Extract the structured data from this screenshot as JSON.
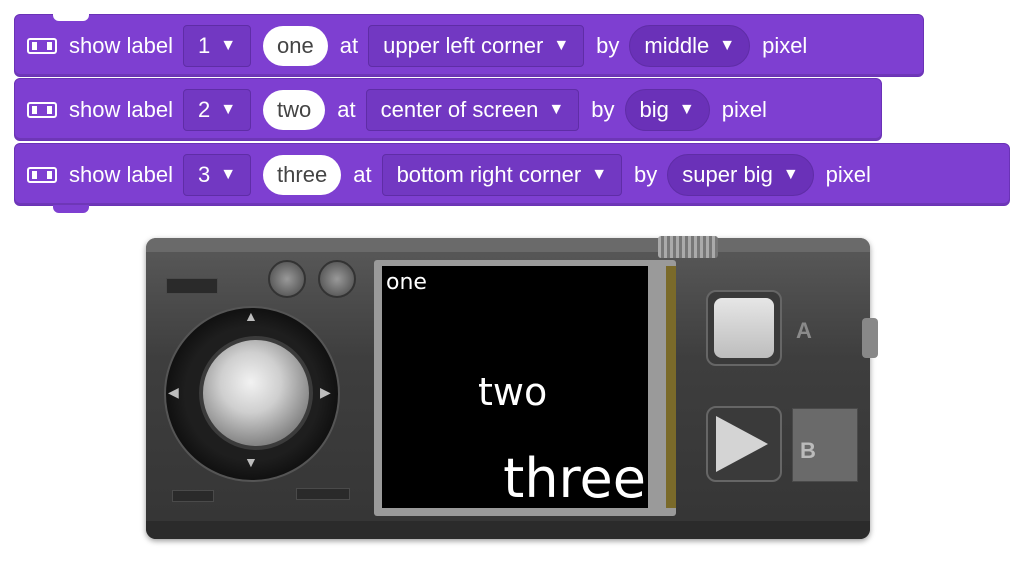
{
  "blocks": [
    {
      "icon": "display-icon",
      "show": "show label",
      "num": "1",
      "text": "one",
      "at": "at",
      "position": "upper left corner",
      "by": "by",
      "size": "middle",
      "unit": "pixel"
    },
    {
      "icon": "display-icon",
      "show": "show label",
      "num": "2",
      "text": "two",
      "at": "at",
      "position": "center of screen",
      "by": "by",
      "size": "big",
      "unit": "pixel"
    },
    {
      "icon": "display-icon",
      "show": "show label",
      "num": "3",
      "text": "three",
      "at": "at",
      "position": "bottom right corner",
      "by": "by",
      "size": "super big",
      "unit": "pixel"
    }
  ],
  "caret": "▼",
  "device": {
    "screen_labels": {
      "one": "one",
      "two": "two",
      "three": "three"
    },
    "button_a": "A",
    "button_b": "B"
  },
  "colors": {
    "block": "#7e3fd1",
    "screen": "#000000"
  }
}
